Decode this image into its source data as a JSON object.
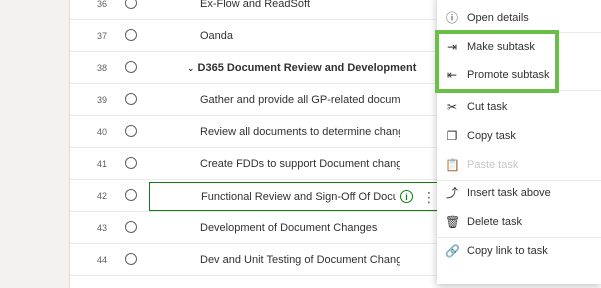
{
  "rows": [
    {
      "num": "36",
      "name": "Ex-Flow and ReadSoft"
    },
    {
      "num": "37",
      "name": "Oanda"
    },
    {
      "num": "38",
      "name": "D365 Document Review and Development"
    },
    {
      "num": "39",
      "name": "Gather and provide all GP-related documen..."
    },
    {
      "num": "40",
      "name": "Review all documents to determine changes..."
    },
    {
      "num": "41",
      "name": "Create FDDs to support Document change r..."
    },
    {
      "num": "42",
      "name": "Functional Review and Sign-Off Of Docu"
    },
    {
      "num": "43",
      "name": "Development of Document Changes"
    },
    {
      "num": "44",
      "name": "Dev and Unit Testing of Document Changes"
    }
  ],
  "parent_chevron": "⌄",
  "info_glyph": "i",
  "more_glyph": "⋮",
  "menu": [
    {
      "label": "Open details",
      "icon": "info-icon",
      "glyph": "ⓘ"
    },
    {
      "label": "Make subtask",
      "icon": "make-subtask-icon",
      "glyph": "⇥"
    },
    {
      "label": "Promote subtask",
      "icon": "promote-subtask-icon",
      "glyph": "⇤"
    },
    {
      "label": "Cut task",
      "icon": "scissors-icon",
      "glyph": "✂"
    },
    {
      "label": "Copy task",
      "icon": "copy-icon",
      "glyph": "❐"
    },
    {
      "label": "Paste task",
      "icon": "paste-icon",
      "glyph": "📋"
    },
    {
      "label": "Insert task above",
      "icon": "insert-above-icon",
      "glyph": "⤴"
    },
    {
      "label": "Delete task",
      "icon": "trash-icon",
      "glyph": "🗑"
    },
    {
      "label": "Copy link to task",
      "icon": "link-icon",
      "glyph": "🔗"
    }
  ],
  "colors": {
    "accent_green": "#107c10",
    "highlight_green": "#6abf48",
    "disabled_text": "#c8c6c4"
  }
}
